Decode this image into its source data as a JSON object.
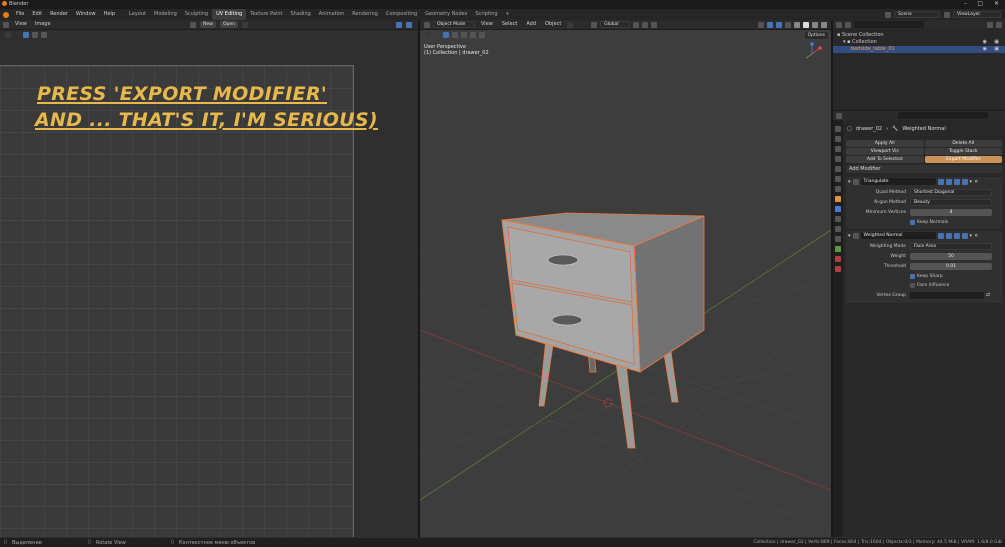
{
  "app": {
    "title": "Blender"
  },
  "menubar": {
    "menus": [
      "File",
      "Edit",
      "Render",
      "Window",
      "Help"
    ],
    "workspaces": [
      "Layout",
      "Modeling",
      "Sculpting",
      "UV Editing",
      "Texture Paint",
      "Shading",
      "Animation",
      "Rendering",
      "Compositing",
      "Geometry Nodes",
      "Scripting"
    ],
    "add_tab": "+",
    "scene_label": "Scene",
    "viewlayer_label": "ViewLayer"
  },
  "uv_editor": {
    "menus": [
      "View",
      "Image"
    ],
    "new_label": "New",
    "open_label": "Open",
    "caption_line1": "PRESS 'EXPORT MODIFIER'",
    "caption_line2": "AND ... THAT'S IT, I'M SERIOUS)"
  },
  "viewport": {
    "mode": "Object Mode",
    "menus": [
      "View",
      "Select",
      "Add",
      "Object"
    ],
    "transform_orientation": "Global",
    "options_label": "Options",
    "perspective_label": "User Perspective",
    "collection_label": "(1) Collection | drawer_02"
  },
  "outliner": {
    "scene_collection": "Scene Collection",
    "collection": "Collection",
    "object": "bedside_table_01"
  },
  "properties": {
    "breadcrumb_object": "drawer_02",
    "breadcrumb_modifier": "Weighted Normal",
    "buttons": {
      "apply_all": "Apply All",
      "delete_all": "Delete All",
      "viewport_vis": "Viewport Vis",
      "toggle_stack": "Toggle Stack",
      "add_to_selected": "Add To Selected",
      "export_modifier": "Export Modifier"
    },
    "add_modifier": "Add Modifier",
    "triangulate": {
      "name": "Triangulate",
      "quad_method_label": "Quad Method",
      "quad_method_value": "Shortest Diagonal",
      "ngon_method_label": "N-gon Method",
      "ngon_method_value": "Beauty",
      "min_vertices_label": "Minimum Vertices",
      "min_vertices_value": "4",
      "keep_normals_label": "Keep Normals"
    },
    "weighted_normal": {
      "name": "Weighted Normal",
      "weighting_mode_label": "Weighting Mode",
      "weighting_mode_value": "Face Area",
      "weight_label": "Weight",
      "weight_value": "50",
      "threshold_label": "Threshold",
      "threshold_value": "0.01",
      "keep_sharp_label": "Keep Sharp",
      "face_influence_label": "Face Influence",
      "vertex_group_label": "Vertex Group"
    }
  },
  "statusbar": {
    "left1": "Выделение",
    "left2": "Rotate View",
    "left3": "Контекстное меню объектов",
    "right": "Collection | drawer_02 | Verts:869 | Faces:804 | Tris:1604 | Objects:0/3 | Memory: 44.5 MiB | VRAM: 1.6/8.0 GiB"
  },
  "colors": {
    "accent": "#e8b84a",
    "export_button": "#c9935a",
    "selection_outline": "#f07a3a",
    "active_tab": "#3d3d3d"
  }
}
